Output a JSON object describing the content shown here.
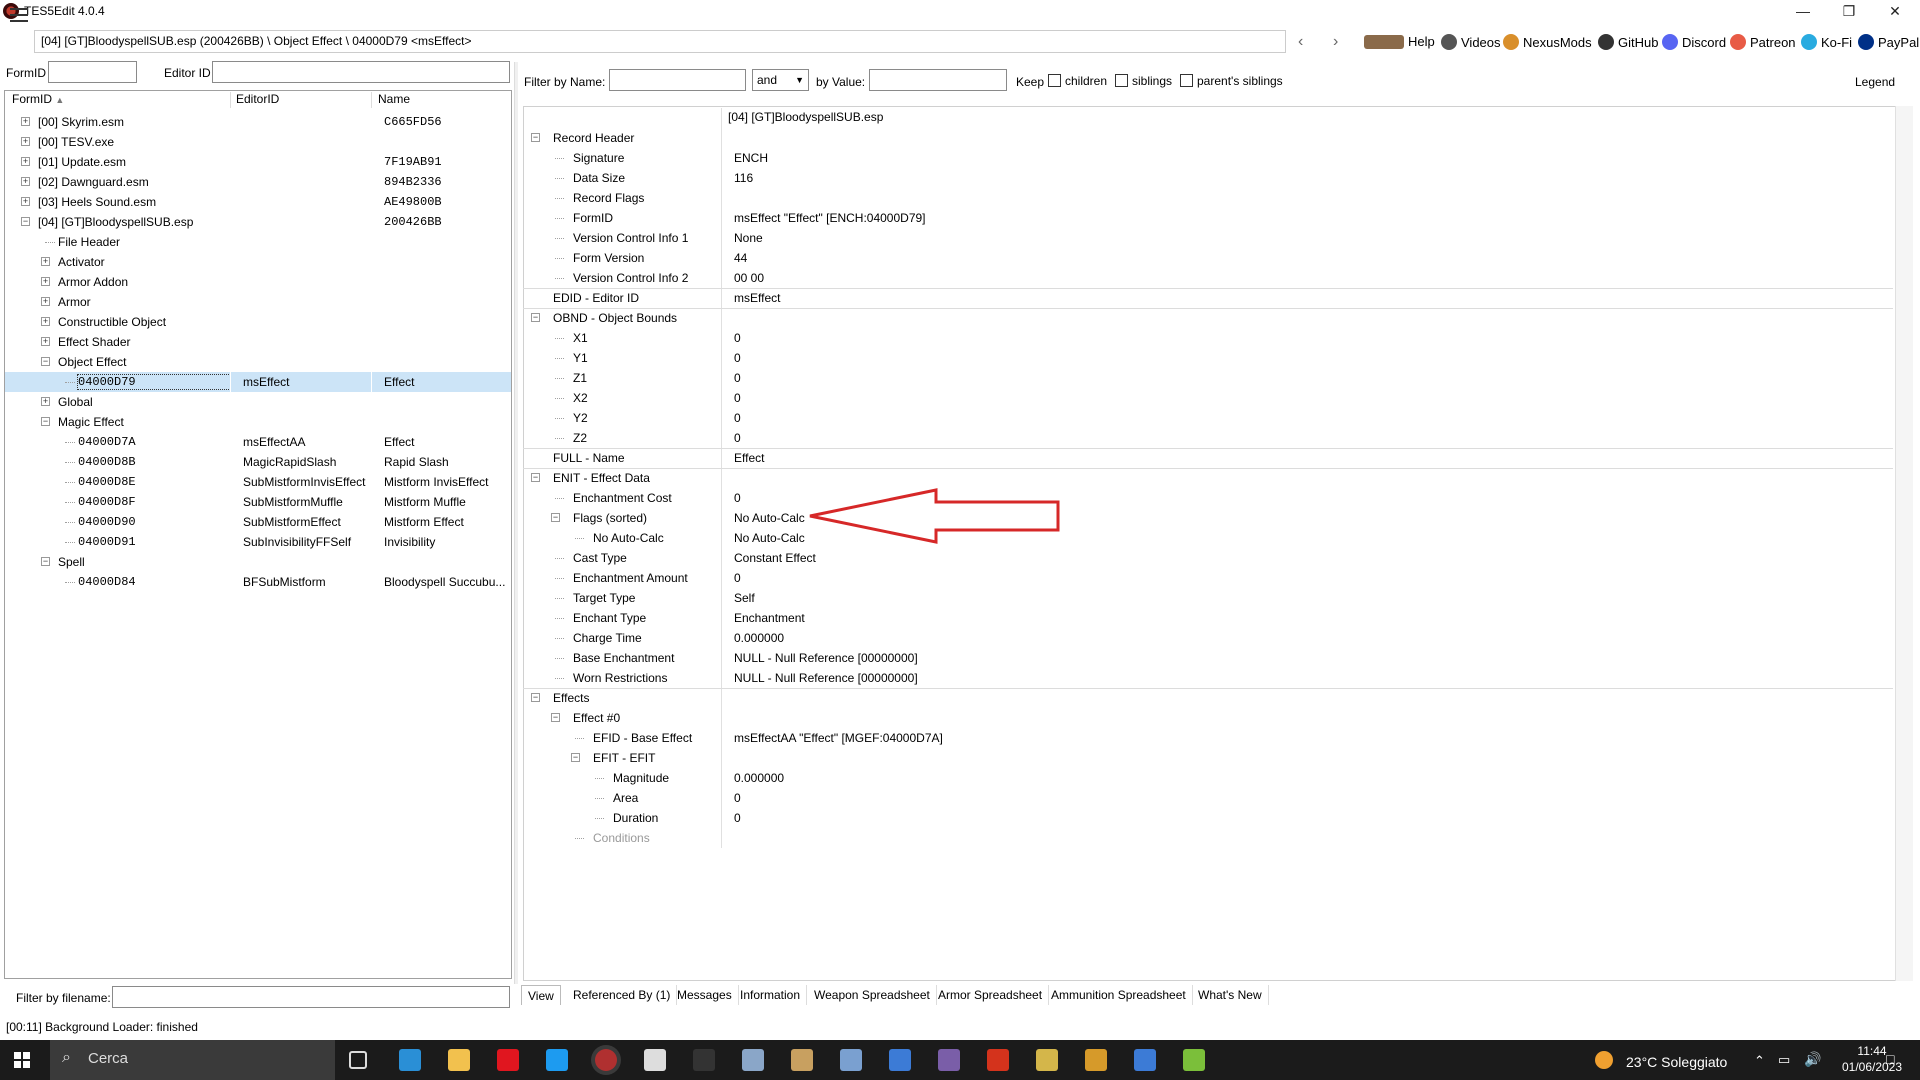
{
  "window": {
    "title": "TES5Edit 4.0.4",
    "controls": [
      "—",
      "❐",
      "✕"
    ]
  },
  "toolbar": {
    "path": "[04] [GT]BloodyspellSUB.esp (200426BB) \\ Object Effect \\ 04000D79 <msEffect>",
    "links": [
      {
        "label": "Help",
        "icon": "book-icon",
        "color": "#8a6a4a"
      },
      {
        "label": "Videos",
        "icon": "video-icon",
        "color": "#555555"
      },
      {
        "label": "NexusMods",
        "icon": "nexusmods-icon",
        "color": "#d98f2b"
      },
      {
        "label": "GitHub",
        "icon": "github-icon",
        "color": "#333333"
      },
      {
        "label": "Discord",
        "icon": "discord-icon",
        "color": "#5865f2"
      },
      {
        "label": "Patreon",
        "icon": "patreon-icon",
        "color": "#e85b46"
      },
      {
        "label": "Ko-Fi",
        "icon": "kofi-icon",
        "color": "#29abe0"
      },
      {
        "label": "PayPal",
        "icon": "paypal-icon",
        "color": "#003087"
      }
    ]
  },
  "left": {
    "formid_label": "FormID",
    "editorid_label": "Editor ID",
    "columns": [
      "FormID",
      "EditorID",
      "Name"
    ],
    "filter_filename_label": "Filter by filename:",
    "tree": [
      {
        "level": 0,
        "expander": "+",
        "formid": "[00] Skyrim.esm",
        "editorid": "",
        "name": "C665FD56",
        "mono_name": true
      },
      {
        "level": 0,
        "expander": "+",
        "formid": "[00] TESV.exe",
        "editorid": "",
        "name": "",
        "mono_name": false
      },
      {
        "level": 0,
        "expander": "+",
        "formid": "[01] Update.esm",
        "editorid": "",
        "name": "7F19AB91",
        "mono_name": true
      },
      {
        "level": 0,
        "expander": "+",
        "formid": "[02] Dawnguard.esm",
        "editorid": "",
        "name": "894B2336",
        "mono_name": true
      },
      {
        "level": 0,
        "expander": "+",
        "formid": "[03] Heels Sound.esm",
        "editorid": "",
        "name": "AE49800B",
        "mono_name": true
      },
      {
        "level": 0,
        "expander": "−",
        "formid": "[04] [GT]BloodyspellSUB.esp",
        "editorid": "",
        "name": "200426BB",
        "mono_name": true
      },
      {
        "level": 1,
        "expander": "",
        "formid": "File Header",
        "editorid": "",
        "name": "",
        "mono_name": false
      },
      {
        "level": 1,
        "expander": "+",
        "formid": "Activator",
        "editorid": "",
        "name": "",
        "mono_name": false
      },
      {
        "level": 1,
        "expander": "+",
        "formid": "Armor Addon",
        "editorid": "",
        "name": "",
        "mono_name": false
      },
      {
        "level": 1,
        "expander": "+",
        "formid": "Armor",
        "editorid": "",
        "name": "",
        "mono_name": false
      },
      {
        "level": 1,
        "expander": "+",
        "formid": "Constructible Object",
        "editorid": "",
        "name": "",
        "mono_name": false
      },
      {
        "level": 1,
        "expander": "+",
        "formid": "Effect Shader",
        "editorid": "",
        "name": "",
        "mono_name": false
      },
      {
        "level": 1,
        "expander": "−",
        "formid": "Object Effect",
        "editorid": "",
        "name": "",
        "mono_name": false
      },
      {
        "level": 2,
        "expander": "",
        "formid": "04000D79",
        "editorid": "msEffect",
        "name": "Effect",
        "mono_name": false,
        "mono_formid": true,
        "selected": true
      },
      {
        "level": 1,
        "expander": "+",
        "formid": "Global",
        "editorid": "",
        "name": "",
        "mono_name": false
      },
      {
        "level": 1,
        "expander": "−",
        "formid": "Magic Effect",
        "editorid": "",
        "name": "",
        "mono_name": false
      },
      {
        "level": 2,
        "expander": "",
        "formid": "04000D7A",
        "editorid": "msEffectAA",
        "name": "Effect",
        "mono_name": false,
        "mono_formid": true
      },
      {
        "level": 2,
        "expander": "",
        "formid": "04000D8B",
        "editorid": "MagicRapidSlash",
        "name": "Rapid Slash",
        "mono_name": false,
        "mono_formid": true
      },
      {
        "level": 2,
        "expander": "",
        "formid": "04000D8E",
        "editorid": "SubMistformInvisEffect",
        "name": "Mistform InvisEffect",
        "mono_name": false,
        "mono_formid": true
      },
      {
        "level": 2,
        "expander": "",
        "formid": "04000D8F",
        "editorid": "SubMistformMuffle",
        "name": "Mistform Muffle",
        "mono_name": false,
        "mono_formid": true
      },
      {
        "level": 2,
        "expander": "",
        "formid": "04000D90",
        "editorid": "SubMistformEffect",
        "name": "Mistform Effect",
        "mono_name": false,
        "mono_formid": true
      },
      {
        "level": 2,
        "expander": "",
        "formid": "04000D91",
        "editorid": "SubInvisibilityFFSelf",
        "name": "Invisibility",
        "mono_name": false,
        "mono_formid": true
      },
      {
        "level": 1,
        "expander": "−",
        "formid": "Spell",
        "editorid": "",
        "name": "",
        "mono_name": false
      },
      {
        "level": 2,
        "expander": "",
        "formid": "04000D84",
        "editorid": "BFSubMistform",
        "name": "Bloodyspell Succubu...",
        "mono_name": false,
        "mono_formid": true
      }
    ]
  },
  "right": {
    "filter_name_label": "Filter by Name:",
    "and_option": "and",
    "by_value_label": "by Value:",
    "keep_label": "Keep",
    "children_label": "children",
    "siblings_label": "siblings",
    "parents_siblings_label": "parent's siblings",
    "legend_label": "Legend",
    "file_header": "[04] [GT]BloodyspellSUB.esp",
    "records": [
      {
        "level": 0,
        "expander": "−",
        "label": "Record Header",
        "value": ""
      },
      {
        "level": 1,
        "expander": "",
        "label": "Signature",
        "value": "ENCH"
      },
      {
        "level": 1,
        "expander": "",
        "label": "Data Size",
        "value": "116"
      },
      {
        "level": 1,
        "expander": "",
        "label": "Record Flags",
        "value": ""
      },
      {
        "level": 1,
        "expander": "",
        "label": "FormID",
        "value": "msEffect \"Effect\" [ENCH:04000D79]"
      },
      {
        "level": 1,
        "expander": "",
        "label": "Version Control Info 1",
        "value": "None"
      },
      {
        "level": 1,
        "expander": "",
        "label": "Form Version",
        "value": "44"
      },
      {
        "level": 1,
        "expander": "",
        "label": "Version Control Info 2",
        "value": "00 00"
      },
      {
        "level": 0,
        "expander": "",
        "label": "EDID - Editor ID",
        "value": "msEffect",
        "sep": true
      },
      {
        "level": 0,
        "expander": "−",
        "label": "OBND - Object Bounds",
        "value": "",
        "sep": true
      },
      {
        "level": 1,
        "expander": "",
        "label": "X1",
        "value": "0"
      },
      {
        "level": 1,
        "expander": "",
        "label": "Y1",
        "value": "0"
      },
      {
        "level": 1,
        "expander": "",
        "label": "Z1",
        "value": "0"
      },
      {
        "level": 1,
        "expander": "",
        "label": "X2",
        "value": "0"
      },
      {
        "level": 1,
        "expander": "",
        "label": "Y2",
        "value": "0"
      },
      {
        "level": 1,
        "expander": "",
        "label": "Z2",
        "value": "0"
      },
      {
        "level": 0,
        "expander": "",
        "label": "FULL - Name",
        "value": "Effect",
        "sep": true
      },
      {
        "level": 0,
        "expander": "−",
        "label": "ENIT - Effect Data",
        "value": "",
        "sep": true
      },
      {
        "level": 1,
        "expander": "",
        "label": "Enchantment Cost",
        "value": "0"
      },
      {
        "level": 1,
        "expander": "−",
        "label": "Flags (sorted)",
        "value": "No Auto-Calc"
      },
      {
        "level": 2,
        "expander": "",
        "label": "No Auto-Calc",
        "value": "No Auto-Calc"
      },
      {
        "level": 1,
        "expander": "",
        "label": "Cast Type",
        "value": "Constant Effect"
      },
      {
        "level": 1,
        "expander": "",
        "label": "Enchantment Amount",
        "value": "0"
      },
      {
        "level": 1,
        "expander": "",
        "label": "Target Type",
        "value": "Self"
      },
      {
        "level": 1,
        "expander": "",
        "label": "Enchant Type",
        "value": "Enchantment"
      },
      {
        "level": 1,
        "expander": "",
        "label": "Charge Time",
        "value": "0.000000"
      },
      {
        "level": 1,
        "expander": "",
        "label": "Base Enchantment",
        "value": "NULL - Null Reference [00000000]"
      },
      {
        "level": 1,
        "expander": "",
        "label": "Worn Restrictions",
        "value": "NULL - Null Reference [00000000]"
      },
      {
        "level": 0,
        "expander": "−",
        "label": "Effects",
        "value": "",
        "sep": true
      },
      {
        "level": 1,
        "expander": "−",
        "label": "Effect #0",
        "value": ""
      },
      {
        "level": 2,
        "expander": "",
        "label": "EFID - Base Effect",
        "value": "msEffectAA \"Effect\" [MGEF:04000D7A]"
      },
      {
        "level": 2,
        "expander": "−",
        "label": "EFIT - EFIT",
        "value": ""
      },
      {
        "level": 3,
        "expander": "",
        "label": "Magnitude",
        "value": "0.000000"
      },
      {
        "level": 3,
        "expander": "",
        "label": "Area",
        "value": "0"
      },
      {
        "level": 3,
        "expander": "",
        "label": "Duration",
        "value": "0"
      },
      {
        "level": 2,
        "expander": "",
        "label": "Conditions",
        "value": "",
        "gray": true
      }
    ],
    "tabs": [
      "View",
      "Referenced By (1)",
      "Messages",
      "Information",
      "Weapon Spreadsheet",
      "Armor Spreadsheet",
      "Ammunition Spreadsheet",
      "What's New"
    ],
    "arrow_color": "#d62828"
  },
  "status": {
    "text": "[00:11] Background Loader: finished"
  },
  "taskbar": {
    "search_placeholder": "Cerca",
    "weather": "23°C Soleggiato",
    "time": "11:44",
    "date": "01/06/2023",
    "apps": [
      {
        "icon": "task-view-icon",
        "color": "#1b1b1b"
      },
      {
        "icon": "edge-icon",
        "color": "#2a8fd6"
      },
      {
        "icon": "file-explorer-icon",
        "color": "#f2c14e"
      },
      {
        "icon": "opera-icon",
        "color": "#e0161f"
      },
      {
        "icon": "skype-icon",
        "color": "#1d9bf0"
      },
      {
        "icon": "tes5edit-icon",
        "color": "#b03030"
      },
      {
        "icon": "app-people-icon",
        "color": "#dddddd"
      },
      {
        "icon": "app-msi-icon",
        "color": "#333333"
      },
      {
        "icon": "app-bird-icon",
        "color": "#8aa6c8"
      },
      {
        "icon": "app-game-icon",
        "color": "#c8a060"
      },
      {
        "icon": "app-feather-icon",
        "color": "#7aa0d0"
      },
      {
        "icon": "app-window-icon",
        "color": "#3c7bd6"
      },
      {
        "icon": "app-archive-icon",
        "color": "#7a5ea8"
      },
      {
        "icon": "app-f-icon",
        "color": "#d4331c"
      },
      {
        "icon": "app-notepad-icon",
        "color": "#d4b64a"
      },
      {
        "icon": "app-arrow-icon",
        "color": "#d69a2a"
      },
      {
        "icon": "app-window2-icon",
        "color": "#3c7bd6"
      },
      {
        "icon": "app-notepadpp-icon",
        "color": "#7bbf3a"
      }
    ]
  }
}
